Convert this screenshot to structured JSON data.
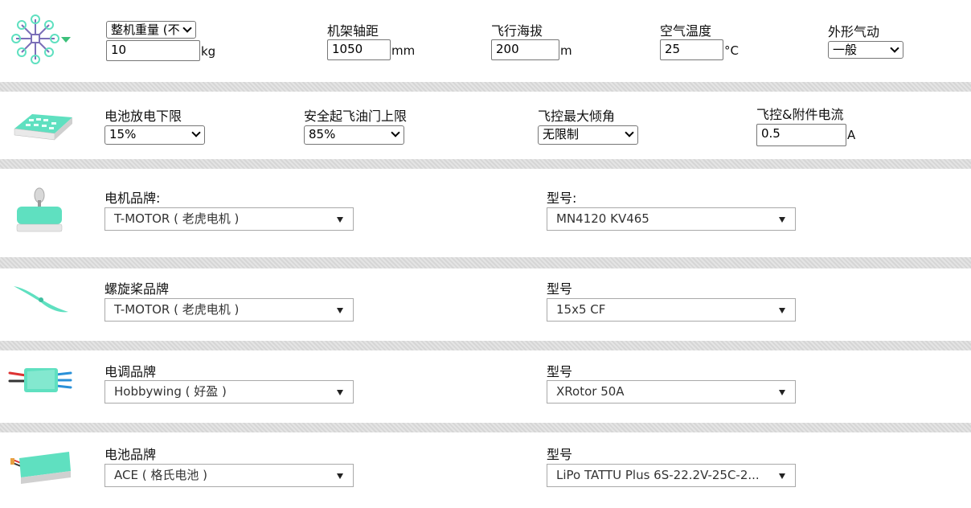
{
  "frame": {
    "weight_mode": "整机重量 (不",
    "weight_value": "10",
    "weight_unit": "kg",
    "wheelbase_label": "机架轴距",
    "wheelbase_value": "1050",
    "wheelbase_unit": "mm",
    "altitude_label": "飞行海拔",
    "altitude_value": "200",
    "altitude_unit": "m",
    "temperature_label": "空气温度",
    "temperature_value": "25",
    "temperature_unit": "°C",
    "aero_label": "外形气动",
    "aero_value": "一般"
  },
  "battery_limits": {
    "discharge_label": "电池放电下限",
    "discharge_value": "15%",
    "throttle_label": "安全起飞油门上限",
    "throttle_value": "85%",
    "tilt_label": "飞控最大倾角",
    "tilt_value": "无限制",
    "current_label": "飞控&附件电流",
    "current_value": "0.5",
    "current_unit": "A"
  },
  "motor": {
    "brand_label": "电机品牌:",
    "brand_value": "T-MOTOR ( 老虎电机 )",
    "model_label": "型号:",
    "model_value": "MN4120 KV465"
  },
  "propeller": {
    "brand_label": "螺旋桨品牌",
    "brand_value": "T-MOTOR ( 老虎电机 )",
    "model_label": "型号",
    "model_value": "15x5 CF"
  },
  "esc": {
    "brand_label": "电调品牌",
    "brand_value": "Hobbywing ( 好盈 )",
    "model_label": "型号",
    "model_value": "XRotor 50A"
  },
  "battery": {
    "brand_label": "电池品牌",
    "brand_value": "ACE ( 格氏电池 )",
    "model_label": "型号",
    "model_value": "LiPo TATTU Plus 6S-22.2V-25C-2..."
  },
  "colors": {
    "accent": "#5fe0c0",
    "background": "#dcdcdc",
    "panel": "#ffffff"
  }
}
